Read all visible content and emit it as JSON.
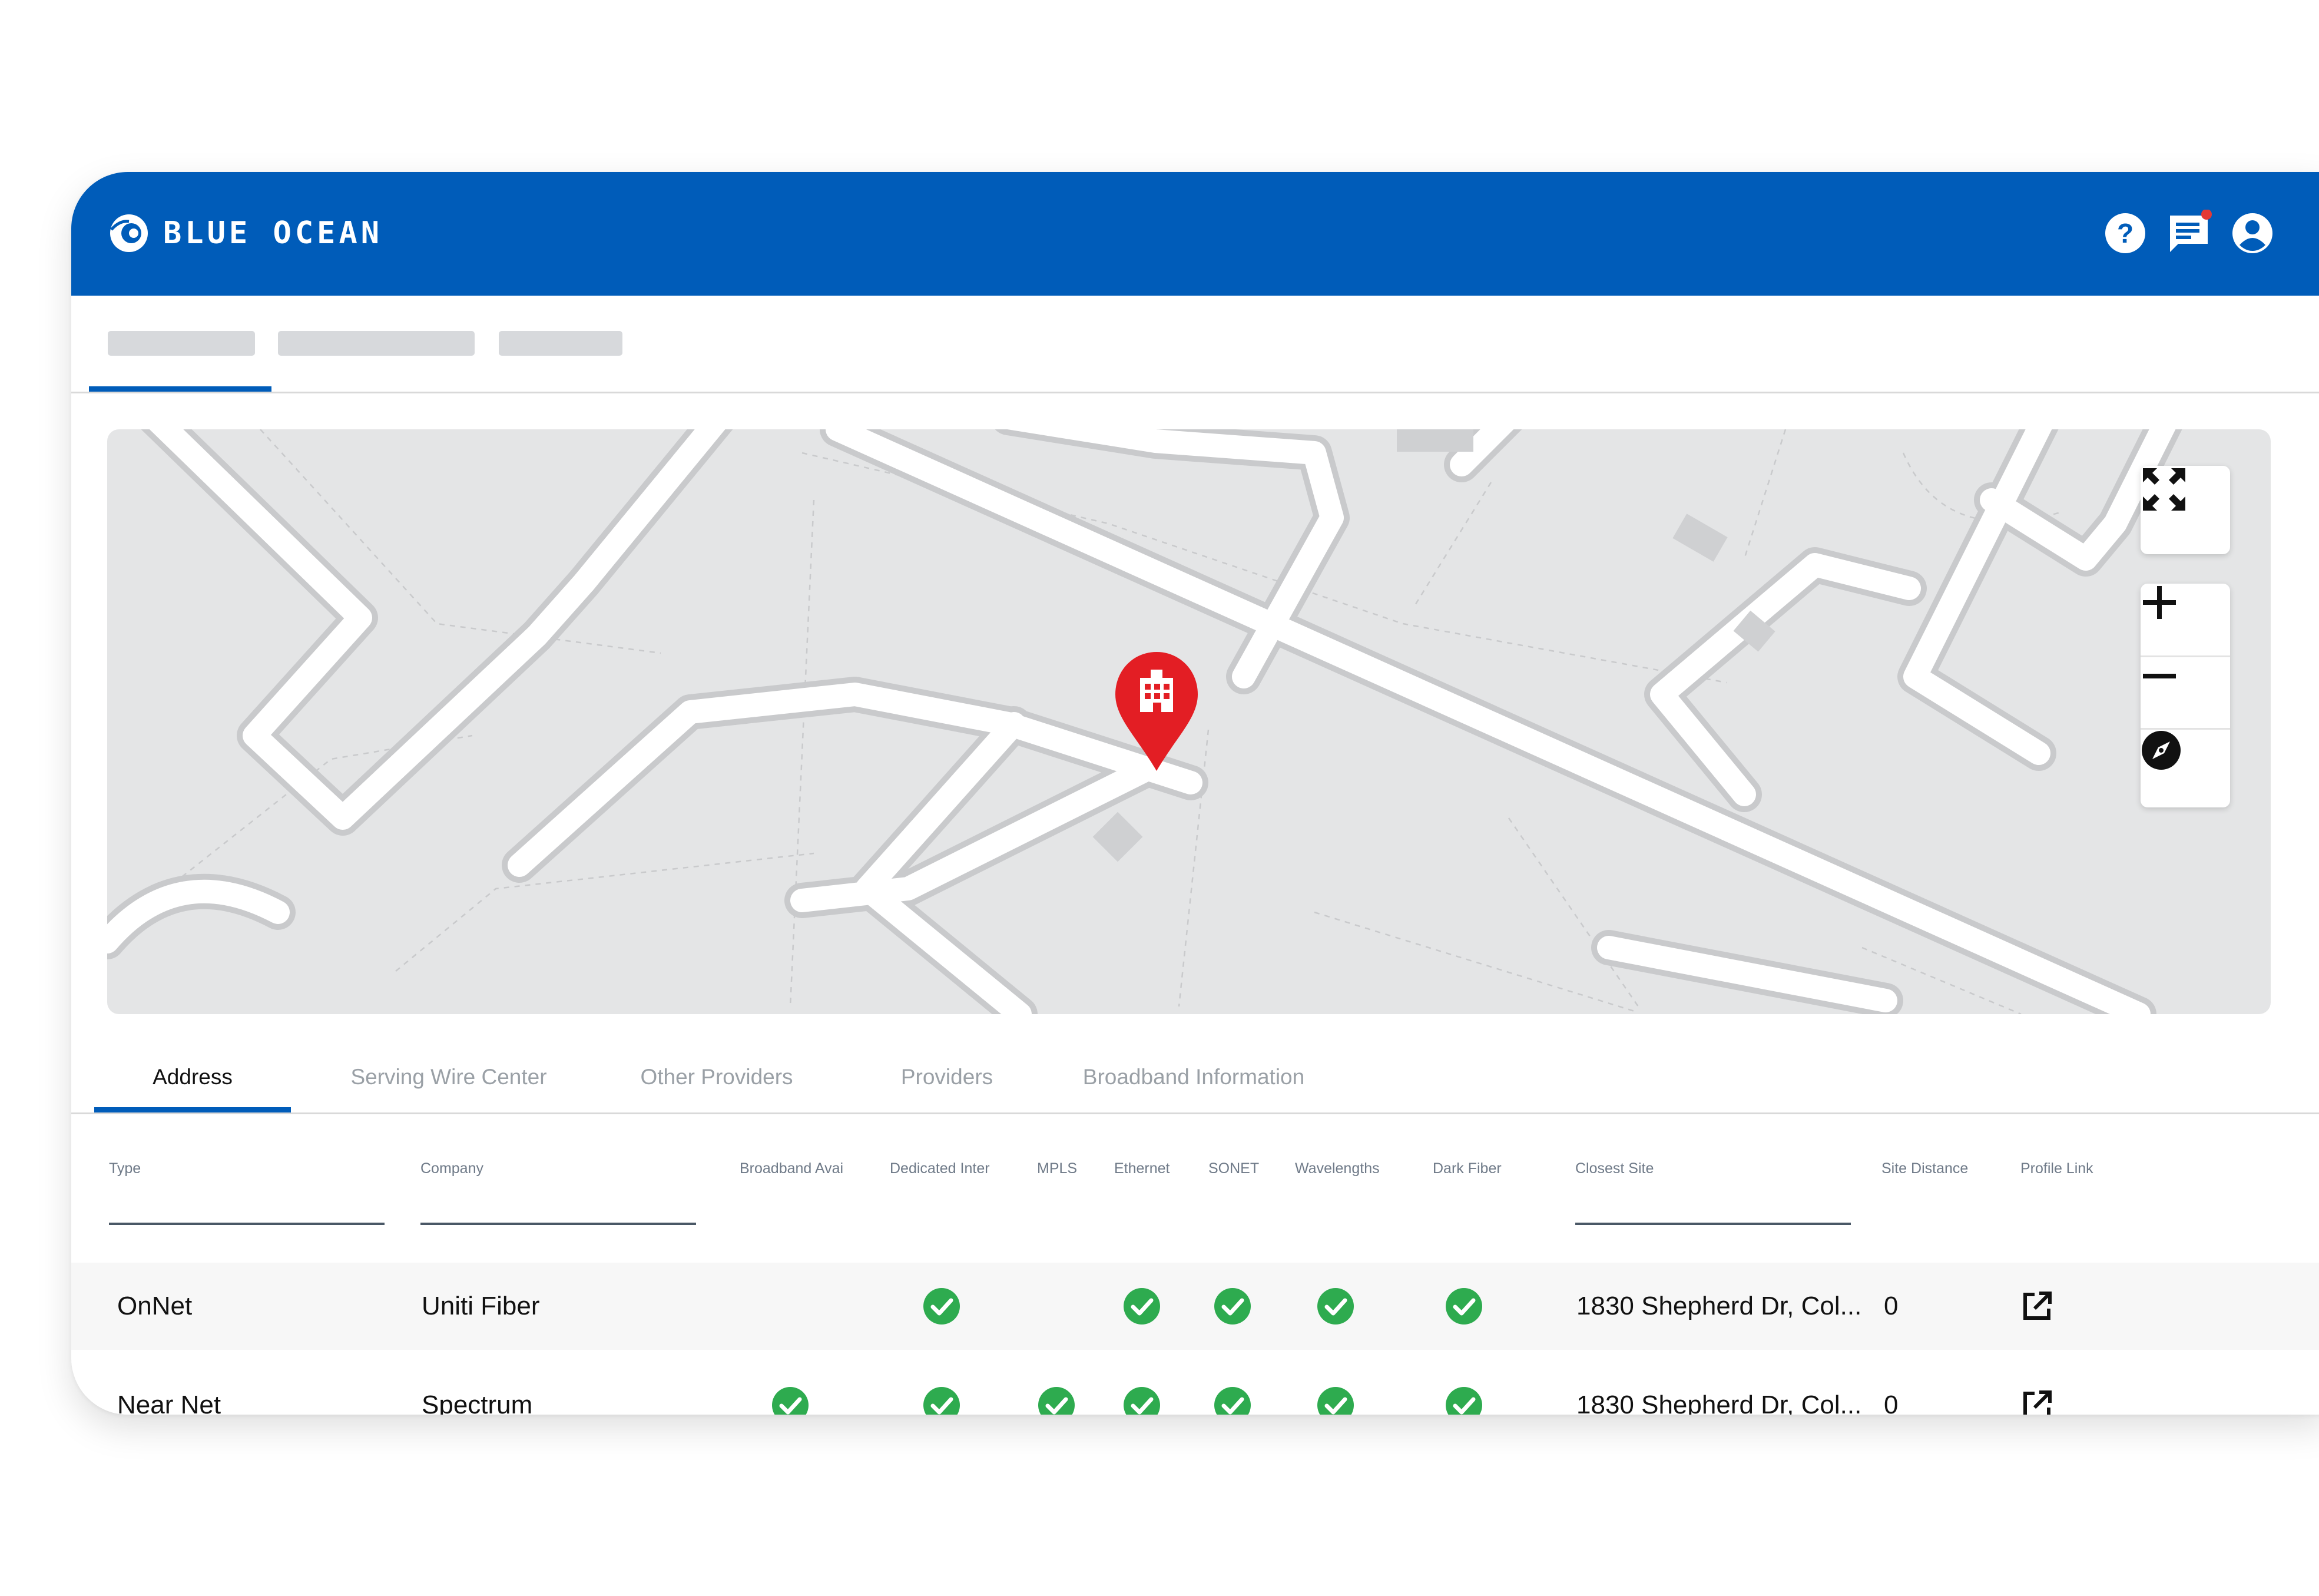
{
  "app": {
    "brand": "BLUE OCEAN",
    "primary_color": "#005cb9",
    "notification_dot_color": "#e53935"
  },
  "header_icons": [
    "help-icon",
    "messages-icon",
    "account-icon"
  ],
  "map": {
    "pin_color": "#e31e24",
    "pin_icon": "building-icon",
    "controls": [
      "fullscreen-icon",
      "zoom-in-icon",
      "zoom-out-icon",
      "compass-icon"
    ]
  },
  "tabs": [
    {
      "label": "Address",
      "active": true
    },
    {
      "label": "Serving Wire Center",
      "active": false
    },
    {
      "label": "Other Providers",
      "active": false
    },
    {
      "label": "Providers",
      "active": false
    },
    {
      "label": "Broadband Information",
      "active": false
    }
  ],
  "table": {
    "columns": [
      "Type",
      "Company",
      "Broadband Avai",
      "Dedicated Inter",
      "MPLS",
      "Ethernet",
      "SONET",
      "Wavelengths",
      "Dark Fiber",
      "Closest Site",
      "Site Distance",
      "Profile Link"
    ],
    "check_color": "#2eab4f",
    "rows": [
      {
        "type": "OnNet",
        "company": "Uniti Fiber",
        "broadband": false,
        "dedicated": true,
        "mpls": false,
        "ethernet": true,
        "sonet": true,
        "wavelengths": true,
        "dark_fiber": true,
        "closest_site": "1830 Shepherd Dr, Col...",
        "site_distance": "0"
      },
      {
        "type": "Near Net",
        "company": "Spectrum",
        "broadband": true,
        "dedicated": true,
        "mpls": true,
        "ethernet": true,
        "sonet": true,
        "wavelengths": true,
        "dark_fiber": true,
        "closest_site": "1830 Shepherd Dr, Col...",
        "site_distance": "0"
      }
    ]
  }
}
